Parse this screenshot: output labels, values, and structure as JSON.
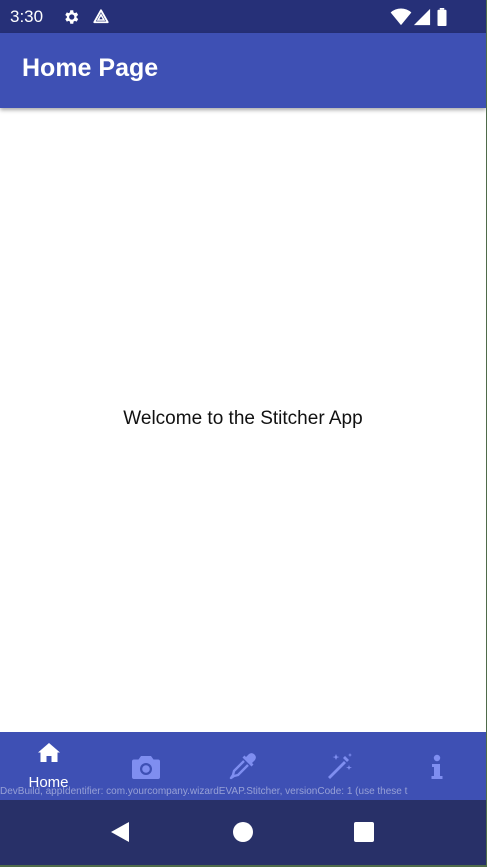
{
  "status_bar": {
    "time": "3:30",
    "icons": [
      "gear-icon",
      "drive-icon",
      "wifi-icon",
      "signal-icon",
      "battery-icon"
    ]
  },
  "app_bar": {
    "title": "Home Page"
  },
  "content": {
    "welcome_text": "Welcome to the Stitcher App"
  },
  "bottom_nav": {
    "items": [
      {
        "label": "Home",
        "icon": "home-icon",
        "selected": true
      },
      {
        "label": "",
        "icon": "camera-icon",
        "selected": false
      },
      {
        "label": "",
        "icon": "eyedropper-icon",
        "selected": false
      },
      {
        "label": "",
        "icon": "magic-wand-icon",
        "selected": false
      },
      {
        "label": "",
        "icon": "info-icon",
        "selected": false
      }
    ]
  },
  "dev_banner": "DevBuild, appIdentifier: com.yourcompany.wizardEVAP.Stitcher, versionCode: 1 (use these t",
  "system_nav": {
    "buttons": [
      "back-icon",
      "home-circle-icon",
      "recents-icon"
    ]
  },
  "colors": {
    "status_bar": "#263078",
    "app_bar": "#3e50b4",
    "inactive_icon": "#7f8ef0",
    "system_nav": "#283068"
  }
}
